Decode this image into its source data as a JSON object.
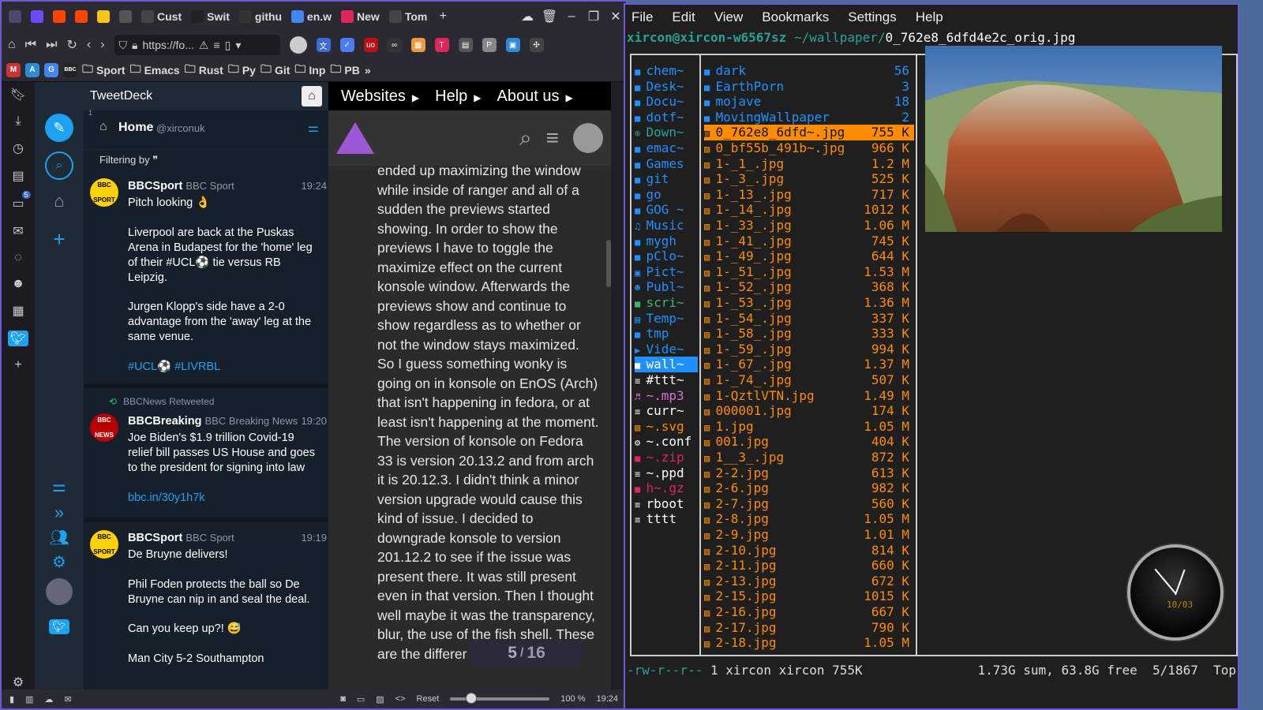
{
  "browser": {
    "tabs": [
      {
        "label": "",
        "icon": "vivaldi-icon",
        "color": "#4a4a6a"
      },
      {
        "label": "",
        "icon": "proton-icon",
        "color": "#6d4aff"
      },
      {
        "label": "",
        "icon": "reddit-icon",
        "color": "#ff4500"
      },
      {
        "label": "",
        "icon": "reddit-icon",
        "color": "#ff4500"
      },
      {
        "label": "",
        "icon": "imdb-icon",
        "color": "#f5c518"
      },
      {
        "label": "",
        "icon": "calendar-icon",
        "color": "#555"
      },
      {
        "label": "Cust",
        "icon": "page-icon",
        "color": "#444"
      },
      {
        "label": "Swit",
        "icon": "dot-icon",
        "color": "#222"
      },
      {
        "label": "githu",
        "icon": "github-icon",
        "color": "#333"
      },
      {
        "label": "en.w",
        "icon": "google-icon",
        "color": "#4285f4"
      },
      {
        "label": "New",
        "icon": "tweetdeck-tab-icon",
        "color": "#e0245e"
      },
      {
        "label": "Tom",
        "icon": "dots-icon",
        "color": "#444"
      }
    ],
    "new_tab": "+",
    "url": "https://fo...",
    "bookmarks": [
      {
        "label": "Sport",
        "kind": "folder"
      },
      {
        "label": "Emacs",
        "kind": "folder"
      },
      {
        "label": "Rust",
        "kind": "folder"
      },
      {
        "label": "Py",
        "kind": "folder"
      },
      {
        "label": "Git",
        "kind": "folder"
      },
      {
        "label": "Inp",
        "kind": "folder"
      },
      {
        "label": "PB",
        "kind": "folder"
      }
    ],
    "bbc_label": "BBC",
    "more": "»",
    "notif_badge": "5"
  },
  "tweetdeck": {
    "title": "TweetDeck",
    "column_title": "Home",
    "column_handle": "@xirconuk",
    "column_index": "1",
    "filtering_label": "Filtering by",
    "tweets": [
      {
        "name": "BBCSport",
        "handle": "BBC Sport",
        "time": "19:24",
        "avatar": "BBC SPORT",
        "lines": [
          "Pitch looking 👌",
          "",
          "Liverpool are back at the Puskas",
          "Arena in Budapest for the 'home' leg",
          "of their #UCL⚽ tie versus RB",
          "Leipzig.",
          "",
          "Jurgen Klopp's side have a 2-0",
          "advantage from the 'away' leg at the",
          "same venue.",
          "",
          "#UCL⚽ #LIVRBL"
        ]
      },
      {
        "retweet": "BBCNews Retweeted",
        "name": "BBCBreaking",
        "handle": "BBC Breaking News",
        "time": "19:20",
        "avatar": "BBC NEWS",
        "lines": [
          "Joe Biden's $1.9 trillion Covid-19",
          "relief bill passes US House and goes",
          "to the president for signing into law",
          "",
          "bbc.in/30y1h7k"
        ]
      },
      {
        "name": "BBCSport",
        "handle": "BBC Sport",
        "time": "19:19",
        "avatar": "BBC SPORT",
        "lines": [
          "De Bruyne delivers!",
          "",
          "Phil Foden protects the ball so De",
          "Bruyne can nip in and seal the deal.",
          "",
          "Can you keep up?! 😅",
          "",
          "Man City 5-2 Southampton"
        ]
      }
    ]
  },
  "webpage": {
    "menu": [
      "Websites",
      "Help",
      "About us"
    ],
    "article_lines": [
      "ended up maximizing the window",
      "while inside of ranger and all of a",
      "sudden the previews started",
      "showing. In order to show the",
      "previews I have to toggle the",
      "maximize effect on the current",
      "konsole window. Afterwards the",
      "previews show and continue to",
      "show regardless as to whether or",
      "not the window stays maximized.",
      "So I guess something wonky is",
      "going on in konsole on EnOS (Arch)",
      "that isn't happening in fedora, or at",
      "least isn't happening at the moment.",
      "The version of konsole on Fedora",
      "33 is version 20.13.2 and from arch",
      "it is 20.12.3. I didn't think a minor",
      "version upgrade would cause this",
      "kind of issue. I decided to",
      "downgrade konsole to version",
      "201.12.2 to see if the issue was",
      "present there. It was still present",
      "even in that version. Then I thought",
      "well maybe it was the transparency,",
      "blur, the use of the fish shell. These",
      "are the differer"
    ],
    "pager_current": "5",
    "pager_sep": "/",
    "pager_total": "16"
  },
  "statusbar": {
    "reset": "Reset",
    "zoom": "100 %",
    "time": "19:24"
  },
  "konsole": {
    "menu": [
      "File",
      "Edit",
      "View",
      "Bookmarks",
      "Settings",
      "Help"
    ],
    "path_host": "xircon@xircon-w6567sz",
    "path_dir": "~/wallpaper/",
    "path_file": "0_762e8_6dfd4e2c_orig.jpg",
    "pane1": [
      {
        "name": "chem~",
        "color": "#1e90ff",
        "icon": "folder-icon"
      },
      {
        "name": "Desk~",
        "color": "#1e90ff",
        "icon": "folder-icon"
      },
      {
        "name": "Docu~",
        "color": "#1e90ff",
        "icon": "folder-icon"
      },
      {
        "name": "dotf~",
        "color": "#1e90ff",
        "icon": "folder-icon"
      },
      {
        "name": "Down~",
        "color": "#2aa198",
        "icon": "download-icon"
      },
      {
        "name": "emac~",
        "color": "#1e90ff",
        "icon": "folder-icon"
      },
      {
        "name": "Games",
        "color": "#1e90ff",
        "icon": "folder-icon"
      },
      {
        "name": "git",
        "color": "#1e90ff",
        "icon": "folder-icon"
      },
      {
        "name": "go",
        "color": "#1e90ff",
        "icon": "folder-icon"
      },
      {
        "name": "GOG ~",
        "color": "#1e90ff",
        "icon": "folder-icon"
      },
      {
        "name": "Music",
        "color": "#1e90ff",
        "icon": "music-icon"
      },
      {
        "name": "mygh",
        "color": "#1e90ff",
        "icon": "folder-icon"
      },
      {
        "name": "pClo~",
        "color": "#1e90ff",
        "icon": "folder-icon"
      },
      {
        "name": "Pict~",
        "color": "#1e90ff",
        "icon": "picture-icon"
      },
      {
        "name": "Publ~",
        "color": "#1e90ff",
        "icon": "users-icon"
      },
      {
        "name": "scri~",
        "color": "#3cb371",
        "icon": "folder-icon"
      },
      {
        "name": "Temp~",
        "color": "#1e90ff",
        "icon": "template-icon"
      },
      {
        "name": "tmp",
        "color": "#1e90ff",
        "icon": "folder-icon"
      },
      {
        "name": "Vide~",
        "color": "#1e90ff",
        "icon": "video-icon"
      },
      {
        "name": "wall~",
        "color": "#fff",
        "icon": "folder-icon",
        "selected": true
      },
      {
        "name": "#ttt~",
        "color": "#fff",
        "icon": "file-icon"
      },
      {
        "name": "~.mp3",
        "color": "#da70d6",
        "icon": "audio-icon"
      },
      {
        "name": "curr~",
        "color": "#fff",
        "icon": "file-icon"
      },
      {
        "name": "~.svg",
        "color": "#ff8c00",
        "icon": "image-icon"
      },
      {
        "name": "~.conf",
        "color": "#fff",
        "icon": "gear-icon"
      },
      {
        "name": "~.zip",
        "color": "#e0245e",
        "icon": "archive-icon"
      },
      {
        "name": "~.ppd",
        "color": "#fff",
        "icon": "file-icon"
      },
      {
        "name": "h~.gz",
        "color": "#e0245e",
        "icon": "archive-icon"
      },
      {
        "name": "rboot",
        "color": "#fff",
        "icon": "file-icon"
      },
      {
        "name": "tttt",
        "color": "#fff",
        "icon": "file-icon"
      }
    ],
    "pane2": [
      {
        "name": "dark",
        "size": "56",
        "color": "#1e90ff",
        "icon": "folder-icon"
      },
      {
        "name": "EarthPorn",
        "size": "3",
        "color": "#1e90ff",
        "icon": "folder-icon"
      },
      {
        "name": "mojave",
        "size": "18",
        "color": "#1e90ff",
        "icon": "folder-icon"
      },
      {
        "name": "MovingWallpaper",
        "size": "2",
        "color": "#1e90ff",
        "icon": "folder-icon"
      },
      {
        "name": "0_762e8_6dfd~.jpg",
        "size": "755 K",
        "color": "#ff8c00",
        "icon": "image-icon",
        "selected": true
      },
      {
        "name": "0_bf55b_491b~.jpg",
        "size": "966 K",
        "color": "#ff8c00",
        "icon": "image-icon"
      },
      {
        "name": "1-_1_.jpg",
        "size": "1.2 M",
        "color": "#ff8c00",
        "icon": "image-icon"
      },
      {
        "name": "1-_3_.jpg",
        "size": "525 K",
        "color": "#ff8c00",
        "icon": "image-icon"
      },
      {
        "name": "1-_13_.jpg",
        "size": "717 K",
        "color": "#ff8c00",
        "icon": "image-icon"
      },
      {
        "name": "1-_14_.jpg",
        "size": "1012 K",
        "color": "#ff8c00",
        "icon": "image-icon"
      },
      {
        "name": "1-_33_.jpg",
        "size": "1.06 M",
        "color": "#ff8c00",
        "icon": "image-icon"
      },
      {
        "name": "1-_41_.jpg",
        "size": "745 K",
        "color": "#ff8c00",
        "icon": "image-icon"
      },
      {
        "name": "1-_49_.jpg",
        "size": "644 K",
        "color": "#ff8c00",
        "icon": "image-icon"
      },
      {
        "name": "1-_51_.jpg",
        "size": "1.53 M",
        "color": "#ff8c00",
        "icon": "image-icon"
      },
      {
        "name": "1-_52_.jpg",
        "size": "368 K",
        "color": "#ff8c00",
        "icon": "image-icon"
      },
      {
        "name": "1-_53_.jpg",
        "size": "1.36 M",
        "color": "#ff8c00",
        "icon": "image-icon"
      },
      {
        "name": "1-_54_.jpg",
        "size": "337 K",
        "color": "#ff8c00",
        "icon": "image-icon"
      },
      {
        "name": "1-_58_.jpg",
        "size": "333 K",
        "color": "#ff8c00",
        "icon": "image-icon"
      },
      {
        "name": "1-_59_.jpg",
        "size": "994 K",
        "color": "#ff8c00",
        "icon": "image-icon"
      },
      {
        "name": "1-_67_.jpg",
        "size": "1.37 M",
        "color": "#ff8c00",
        "icon": "image-icon"
      },
      {
        "name": "1-_74_.jpg",
        "size": "507 K",
        "color": "#ff8c00",
        "icon": "image-icon"
      },
      {
        "name": "1-QztlVTN.jpg",
        "size": "1.49 M",
        "color": "#ff8c00",
        "icon": "image-icon"
      },
      {
        "name": "000001.jpg",
        "size": "174 K",
        "color": "#ff8c00",
        "icon": "image-icon"
      },
      {
        "name": "1.jpg",
        "size": "1.05 M",
        "color": "#ff8c00",
        "icon": "image-icon"
      },
      {
        "name": "001.jpg",
        "size": "404 K",
        "color": "#ff8c00",
        "icon": "image-icon"
      },
      {
        "name": "1__3_.jpg",
        "size": "872 K",
        "color": "#ff8c00",
        "icon": "image-icon"
      },
      {
        "name": "2-2.jpg",
        "size": "613 K",
        "color": "#ff8c00",
        "icon": "image-icon"
      },
      {
        "name": "2-6.jpg",
        "size": "982 K",
        "color": "#ff8c00",
        "icon": "image-icon"
      },
      {
        "name": "2-7.jpg",
        "size": "560 K",
        "color": "#ff8c00",
        "icon": "image-icon"
      },
      {
        "name": "2-8.jpg",
        "size": "1.05 M",
        "color": "#ff8c00",
        "icon": "image-icon"
      },
      {
        "name": "2-9.jpg",
        "size": "1.01 M",
        "color": "#ff8c00",
        "icon": "image-icon"
      },
      {
        "name": "2-10.jpg",
        "size": "814 K",
        "color": "#ff8c00",
        "icon": "image-icon"
      },
      {
        "name": "2-11.jpg",
        "size": "660 K",
        "color": "#ff8c00",
        "icon": "image-icon"
      },
      {
        "name": "2-13.jpg",
        "size": "672 K",
        "color": "#ff8c00",
        "icon": "image-icon"
      },
      {
        "name": "2-15.jpg",
        "size": "1015 K",
        "color": "#ff8c00",
        "icon": "image-icon"
      },
      {
        "name": "2-16.jpg",
        "size": "667 K",
        "color": "#ff8c00",
        "icon": "image-icon"
      },
      {
        "name": "2-17.jpg",
        "size": "790 K",
        "color": "#ff8c00",
        "icon": "image-icon"
      },
      {
        "name": "2-18.jpg",
        "size": "1.05 M",
        "color": "#ff8c00",
        "icon": "image-icon"
      }
    ],
    "status_perm": "-rw-r--r--",
    "status_info": "1 xircon xircon 755K",
    "status_right": "1.73G sum, 63.8G free  5/1867  Top",
    "clock_date": "10/03"
  }
}
